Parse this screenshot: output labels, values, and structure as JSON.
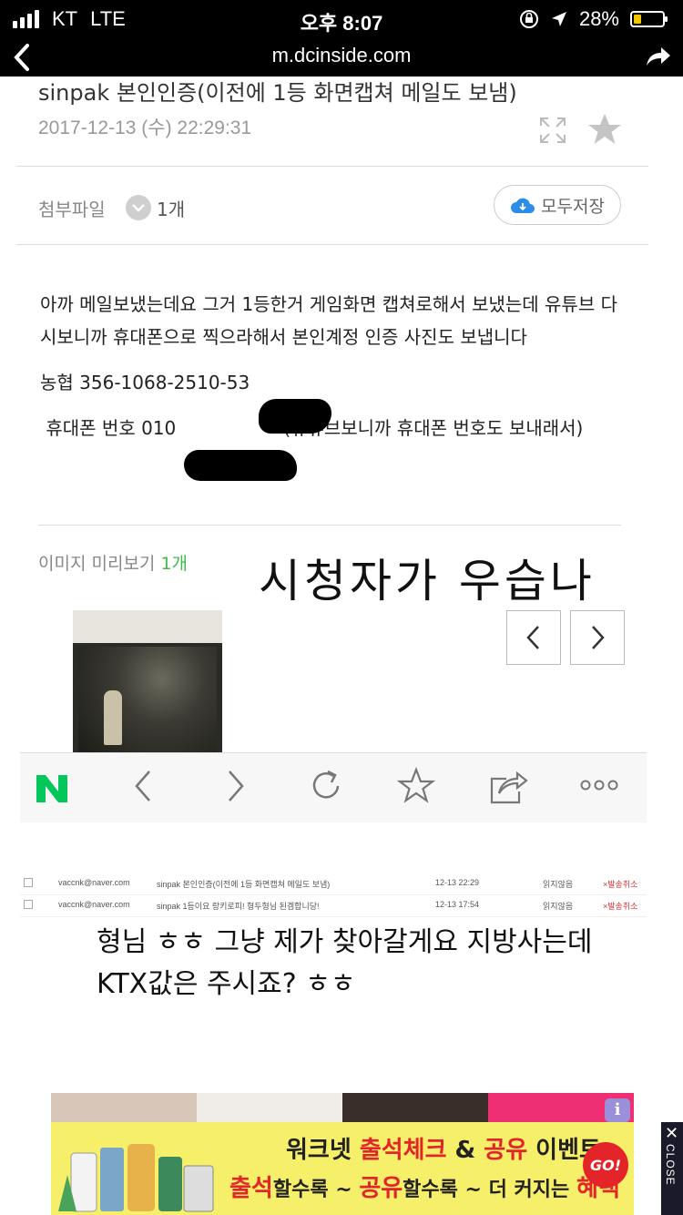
{
  "status": {
    "carrier": "KT",
    "network": "LTE",
    "time": "오후 8:07",
    "battery": "28%",
    "battery_level": 0.28
  },
  "browser": {
    "url": "m.dcinside.com"
  },
  "post": {
    "title": "sinpak 본인인증(이전에 1등 화면캡쳐 메일도 보냄)",
    "date": "2017-12-13 (수) 22:29:31",
    "attachment_label": "첨부파일",
    "attachment_count": "1개",
    "save_all": "모두저장",
    "body": [
      "아까 메일보냈는데요 그거 1등한거 게임화면 캡쳐로해서 보냈는데 유튜브 다시보니까 휴대폰으로 찍으라해서 본인계정 인증 사진도 보냅니다",
      "농협 356-1068-2510-53",
      " 휴대폰 번호 010",
      "(유튜브보니까 휴대폰 번호도 보내래서)"
    ],
    "preview_label": "이미지 미리보기",
    "preview_count": "1개",
    "handwritten_caption": "시청자가 우습나"
  },
  "mail_rows": [
    {
      "from": "vaccnk@naver.com",
      "subject": "sinpak 본인인증(이전에 1등 화면캡쳐 메일도 보냄)",
      "date": "12-13 22:29",
      "status": "읽지않음",
      "cancel": "×발송취소"
    },
    {
      "from": "vaccnk@naver.com",
      "subject": "sinpak 1등이요 랑키로피! 형두형님 된겜합니당!",
      "date": "12-13 17:54",
      "status": "읽지않음",
      "cancel": "×발송취소"
    }
  ],
  "comment": "형님 ㅎㅎ 그냥 제가 찾아갈게요 지방사는데 KTX값은 주시죠? ㅎㅎ",
  "ad": {
    "line1_a": "워크넷 ",
    "line1_b": "출석체크",
    "line1_c": " & ",
    "line1_d": "공유",
    "line1_e": " 이벤트",
    "line2_a": "출석",
    "line2_b": "할수록 ~ ",
    "line2_c": "공유",
    "line2_d": "할수록 ~ 더 커지는 ",
    "line2_e": "혜택",
    "go": "GO!",
    "close": "CLOSE",
    "info": "i"
  },
  "colors": {
    "accent_green": "#3cbb4a",
    "ad_yellow": "#f6ef6a",
    "ad_red": "#e3252a",
    "naver_green": "#03c75a"
  }
}
